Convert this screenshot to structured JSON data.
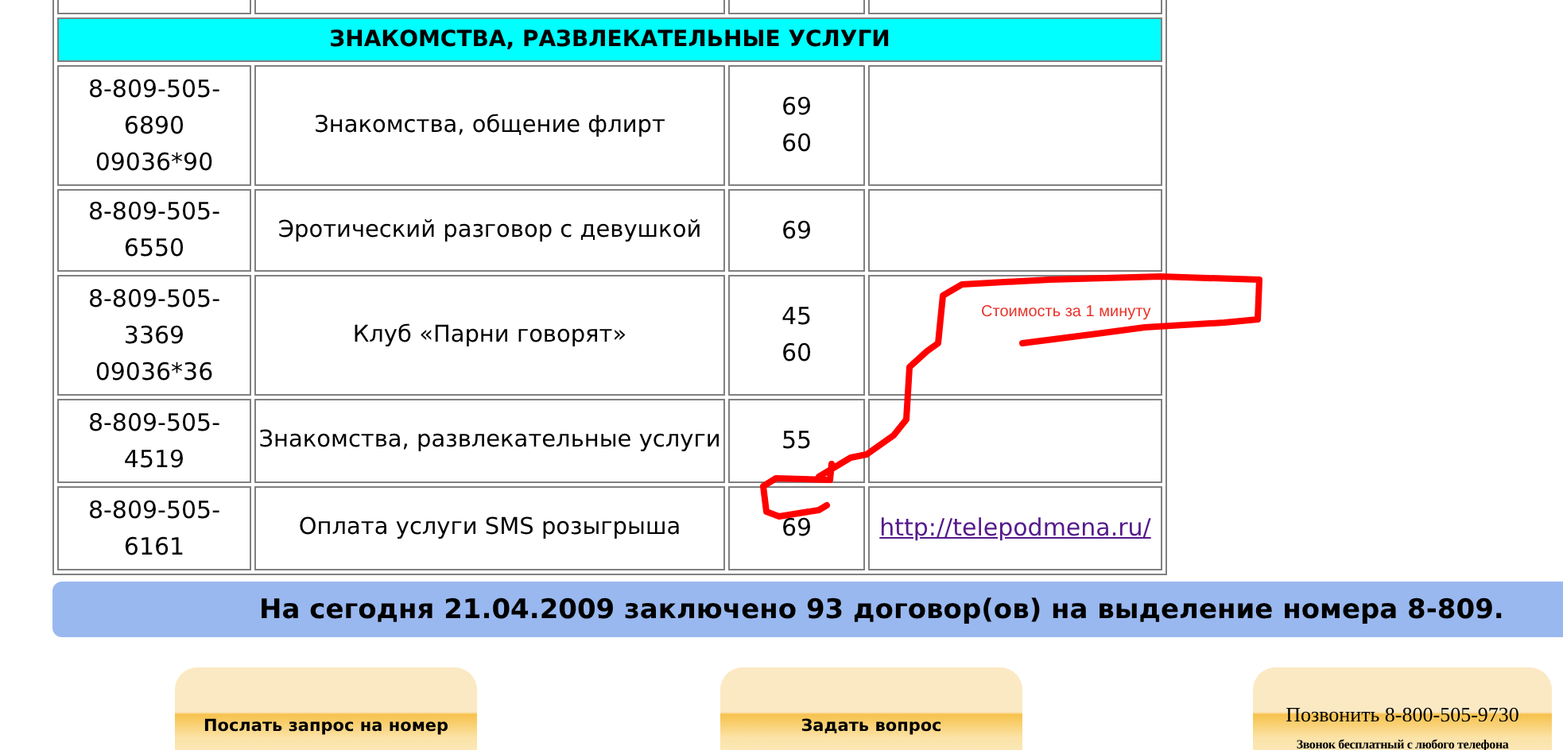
{
  "section_title": "ЗНАКОМСТВА, РАЗВЛЕКАТЕЛЬНЫЕ УСЛУГИ",
  "rows": [
    {
      "number_lines": [
        "8-809-505-",
        "6890",
        "09036*90"
      ],
      "service": "Знакомства, общение флирт",
      "price_lines": [
        "69",
        "60"
      ]
    },
    {
      "number_lines": [
        "8-809-505-",
        "6550"
      ],
      "service": "Эротический разговор с девушкой",
      "price_lines": [
        "69"
      ]
    },
    {
      "number_lines": [
        "8-809-505-",
        "3369",
        "09036*36"
      ],
      "service": "Клуб «Парни говорят»",
      "price_lines": [
        "45",
        "60"
      ]
    },
    {
      "number_lines": [
        "8-809-505-",
        "4519"
      ],
      "service": "Знакомства, развлекательные услуги",
      "price_lines": [
        "55"
      ]
    },
    {
      "number_lines": [
        "8-809-505-",
        "6161"
      ],
      "service": "Оплата услуги SMS розыгрыша",
      "price_lines": [
        "69"
      ],
      "link": "http://telepodmena.ru/"
    }
  ],
  "annotation": {
    "text": "Стоимость за 1 минуту"
  },
  "banner": "На сегодня 21.04.2009 заключено 93 договор(ов) на выделение номера 8-809.",
  "buttons": [
    {
      "kind": "plain",
      "label": "Послать запрос на номер"
    },
    {
      "kind": "plain",
      "label": "Задать вопрос"
    },
    {
      "kind": "call",
      "label": "Позвонить 8-800-505-9730",
      "note": "Звонок бесплатный с любого телефона"
    }
  ]
}
